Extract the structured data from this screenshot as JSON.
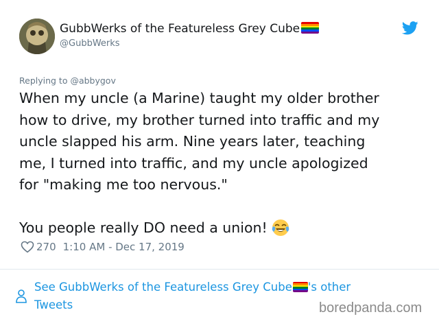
{
  "tweet": {
    "author_name": "GubbWerks of the Featureless Grey Cube",
    "author_handle": "@GubbWerks",
    "replying_to": "Replying to @abbygov",
    "body_lines": [
      "When my uncle (a Marine) taught my older brother",
      "how to drive, my brother turned into traffic and my",
      "uncle slapped his arm. Nine years later, teaching",
      "me, I turned into traffic, and my uncle apologized",
      "for \"making me too nervous.\""
    ],
    "closing_line": "You people really DO need a union!",
    "likes": "270",
    "timestamp": "1:10 AM - Dec 17, 2019"
  },
  "footer": {
    "see_more_prefix": "See GubbWerks of the Featureless Grey Cube",
    "see_more_suffix": "'s other",
    "see_more_line2": "Tweets"
  },
  "watermark": "boredpanda.com",
  "colors": {
    "link_blue": "#1b95e0",
    "secondary_grey": "#657786",
    "twitter_blue": "#1da1f2",
    "divider": "#e1e8ed"
  },
  "icons": [
    "avatar",
    "rainbow-flag-icon",
    "twitter-bird-icon",
    "face-with-tears-of-joy-icon",
    "heart-icon",
    "person-icon"
  ]
}
